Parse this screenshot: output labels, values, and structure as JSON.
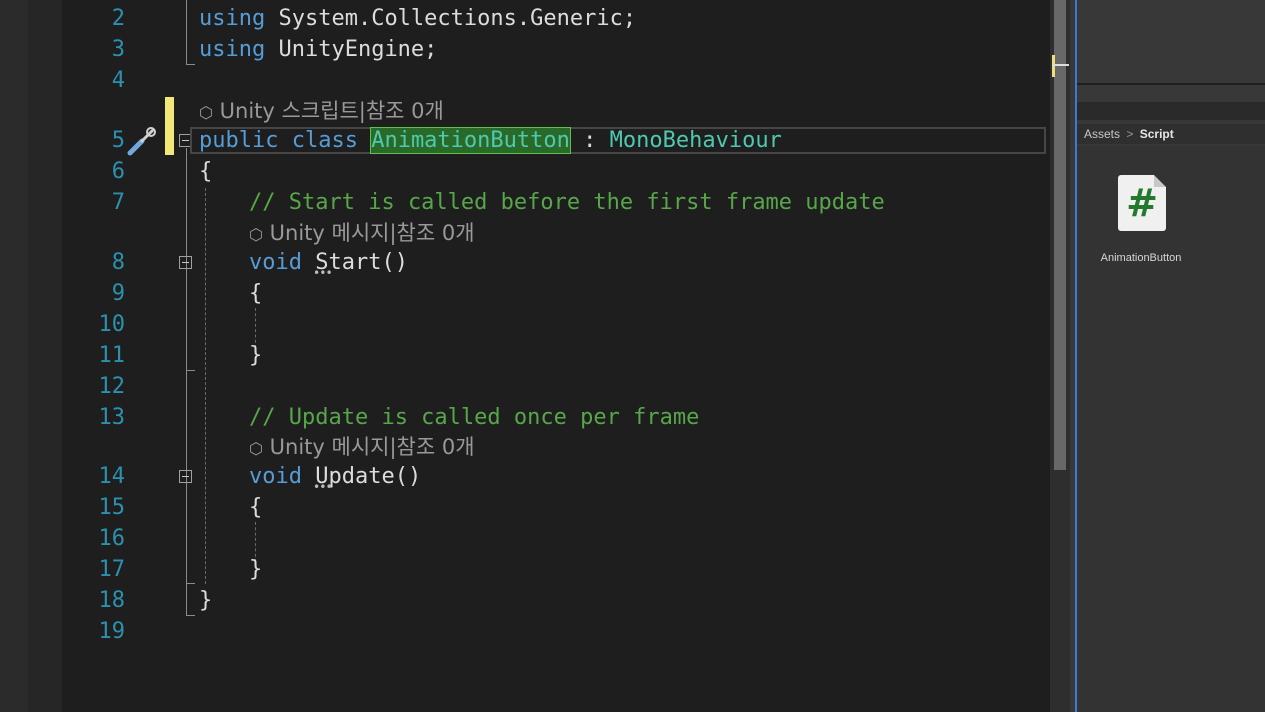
{
  "editor": {
    "line_numbers": [
      "2",
      "3",
      "4",
      "5",
      "6",
      "7",
      "8",
      "9",
      "10",
      "11",
      "12",
      "13",
      "14",
      "15",
      "16",
      "17",
      "18",
      "19"
    ],
    "line2": {
      "kw": "using",
      "rest": " System.Collections.Generic;"
    },
    "line3": {
      "kw": "using",
      "rest": " UnityEngine;"
    },
    "codelens_class": "Unity 스크립트|참조 0개",
    "line5": {
      "kw": "public class",
      "class_name": "AnimationButton",
      "sep": " : ",
      "base": "MonoBehaviour"
    },
    "line6": "{",
    "line7_comment": "// Start is called before the first frame update",
    "codelens_start": "Unity 메시지|참조 0개",
    "line8": {
      "kw": "void",
      "name": "Start",
      "parens": "()"
    },
    "line9": "{",
    "line11": "}",
    "line13_comment": "// Update is called once per frame",
    "codelens_update": "Unity 메시지|참조 0개",
    "line14": {
      "kw": "void",
      "name": "Update",
      "parens": "()"
    },
    "line15": "{",
    "line17": "}",
    "line18": "}"
  },
  "project_panel": {
    "breadcrumb_root": "Assets",
    "breadcrumb_sep": ">",
    "breadcrumb_current": "Script",
    "asset_icon_glyph": "#",
    "asset_name": "AnimationButton"
  },
  "colors": {
    "keyword": "#569cd6",
    "type": "#4ec9b0",
    "comment": "#57a64a",
    "line_number": "#2b91af",
    "background": "#1e1e1e"
  }
}
